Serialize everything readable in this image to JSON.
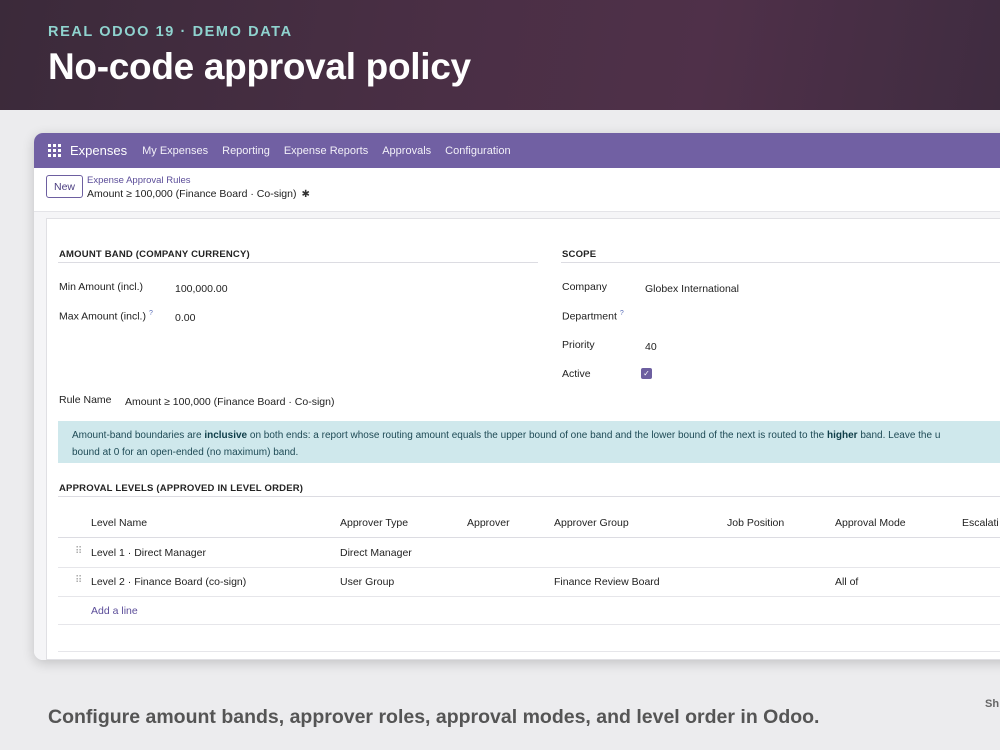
{
  "hero": {
    "kicker": "REAL ODOO 19 · DEMO DATA",
    "title": "No-code approval policy"
  },
  "topnav": {
    "brand": "Expenses",
    "menu": [
      "My Expenses",
      "Reporting",
      "Expense Reports",
      "Approvals",
      "Configuration"
    ]
  },
  "control_panel": {
    "new_label": "New",
    "breadcrumb_parent": "Expense Approval Rules",
    "breadcrumb_current": "Amount ≥ 100,000 (Finance Board · Co-sign)"
  },
  "amount_band": {
    "title": "AMOUNT BAND (COMPANY CURRENCY)",
    "min_label": "Min Amount (incl.)",
    "min_value": "100,000.00",
    "max_label": "Max Amount (incl.)",
    "max_help": "?",
    "max_value": "0.00"
  },
  "scope": {
    "title": "SCOPE",
    "company_label": "Company",
    "company_value": "Globex International",
    "department_label": "Department",
    "department_help": "?",
    "priority_label": "Priority",
    "priority_value": "40",
    "active_label": "Active",
    "active_checked": true
  },
  "rule": {
    "name_label": "Rule Name",
    "name_value": "Amount ≥ 100,000 (Finance Board · Co-sign)"
  },
  "alert": {
    "part1": "Amount-band boundaries are ",
    "bold1": "inclusive",
    "part2": " on both ends: a report whose routing amount equals the upper bound of one band and the lower bound of the next is routed to the ",
    "bold2": "higher",
    "part3": " band. Leave the u",
    "line2": "bound at 0 for an open-ended (no maximum) band."
  },
  "levels": {
    "title": "APPROVAL LEVELS (APPROVED IN LEVEL ORDER)",
    "columns": [
      "Level Name",
      "Approver Type",
      "Approver",
      "Approver Group",
      "Job Position",
      "Approval Mode",
      "Escalati"
    ],
    "rows": [
      {
        "level_name": "Level 1 · Direct Manager",
        "approver_type": "Direct Manager",
        "approver": "",
        "approver_group": "",
        "job_position": "",
        "approval_mode": ""
      },
      {
        "level_name": "Level 2 · Finance Board (co-sign)",
        "approver_type": "User Group",
        "approver": "",
        "approver_group": "Finance Review Board",
        "job_position": "",
        "approval_mode": "All of"
      }
    ],
    "add_line": "Add a line"
  },
  "footer": {
    "caption": "Configure amount bands, approver roles, approval modes, and level order in Odoo.",
    "side_note": "Sh"
  },
  "colors": {
    "nav": "#7160a3",
    "accent": "#5b4d99",
    "alert_bg": "#cfe8ec"
  }
}
